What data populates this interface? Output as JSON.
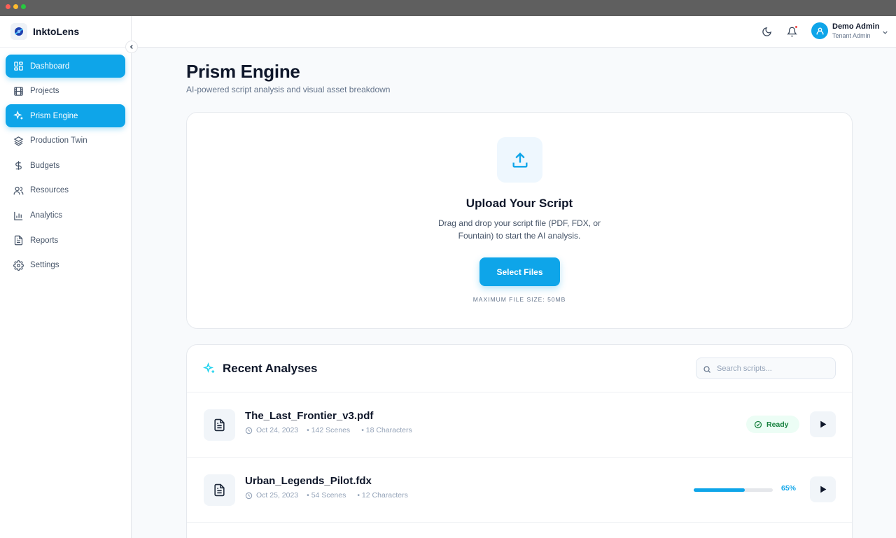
{
  "app": {
    "name": "InktoLens"
  },
  "window": {
    "controls": [
      "close",
      "minimize",
      "maximize"
    ]
  },
  "colors": {
    "accent": "#0ea5e9",
    "ready_bg": "#ecfdf5",
    "ready_text": "#15803d",
    "notification": "#ef4444"
  },
  "sidebar": {
    "items": [
      {
        "label": "Dashboard",
        "icon": "grid-icon",
        "active": true
      },
      {
        "label": "Projects",
        "icon": "film-icon",
        "active": false
      },
      {
        "label": "Prism Engine",
        "icon": "sparkles-icon",
        "active": true
      },
      {
        "label": "Production Twin",
        "icon": "layers-icon",
        "active": false
      },
      {
        "label": "Budgets",
        "icon": "dollar-icon",
        "active": false
      },
      {
        "label": "Resources",
        "icon": "users-icon",
        "active": false
      },
      {
        "label": "Analytics",
        "icon": "bar-chart-icon",
        "active": false
      },
      {
        "label": "Reports",
        "icon": "document-icon",
        "active": false
      },
      {
        "label": "Settings",
        "icon": "gear-icon",
        "active": false
      }
    ]
  },
  "header": {
    "user": {
      "name": "Demo Admin",
      "role": "Tenant Admin"
    }
  },
  "page": {
    "title": "Prism Engine",
    "subtitle": "AI-powered script analysis and visual asset breakdown"
  },
  "upload": {
    "title": "Upload Your Script",
    "description": "Drag and drop your script file (PDF, FDX, or Fountain) to start the AI analysis.",
    "button_label": "Select Files",
    "max_size": "MAXIMUM FILE SIZE: 50MB"
  },
  "recent": {
    "title": "Recent Analyses",
    "search_placeholder": "Search scripts...",
    "items": [
      {
        "name": "The_Last_Frontier_v3.pdf",
        "date": "Oct 24, 2023",
        "scenes": "• 142 Scenes",
        "characters": "• 18 Characters",
        "status": "Ready",
        "progress": null
      },
      {
        "name": "Urban_Legends_Pilot.fdx",
        "date": "Oct 25, 2023",
        "scenes": "• 54 Scenes",
        "characters": "• 12 Characters",
        "status": null,
        "progress": 65,
        "progress_label": "65%"
      }
    ]
  }
}
